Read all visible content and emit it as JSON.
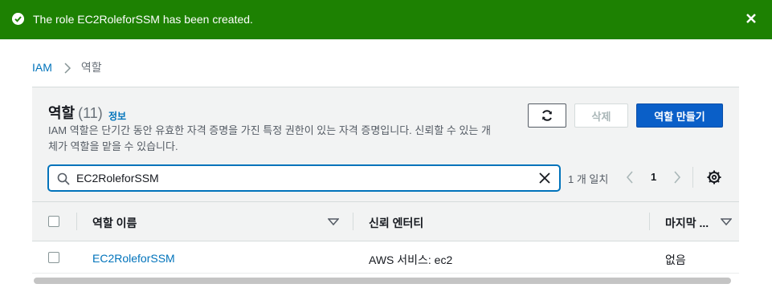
{
  "flash": {
    "message": "The role EC2RoleforSSM has been created."
  },
  "breadcrumb": {
    "root": "IAM",
    "current": "역할"
  },
  "header": {
    "title": "역할",
    "count": "(11)",
    "info": "정보",
    "description": "IAM 역할은 단기간 동안 유효한 자격 증명을 가진 특정 권한이 있는 자격 증명입니다. 신뢰할 수 있는 개체가 역할을 맡을 수 있습니다."
  },
  "buttons": {
    "delete": "삭제",
    "create": "역할 만들기"
  },
  "search": {
    "value": "EC2RoleforSSM",
    "matches": "1 개 일치",
    "page": "1"
  },
  "table": {
    "columns": [
      "역할 이름",
      "신뢰 엔터티",
      "마지막 ..."
    ],
    "rows": [
      {
        "name": "EC2RoleforSSM",
        "trusted": "AWS 서비스: ec2",
        "last": "없음"
      }
    ]
  },
  "colors": {
    "success": "#1d8102",
    "primary": "#0a5fc8",
    "link": "#0073bb"
  },
  "icons": [
    "check-circle-icon",
    "close-icon",
    "chevron-right-icon",
    "refresh-icon",
    "search-icon",
    "clear-icon",
    "chevron-left-icon",
    "gear-icon",
    "sort-down-icon"
  ]
}
